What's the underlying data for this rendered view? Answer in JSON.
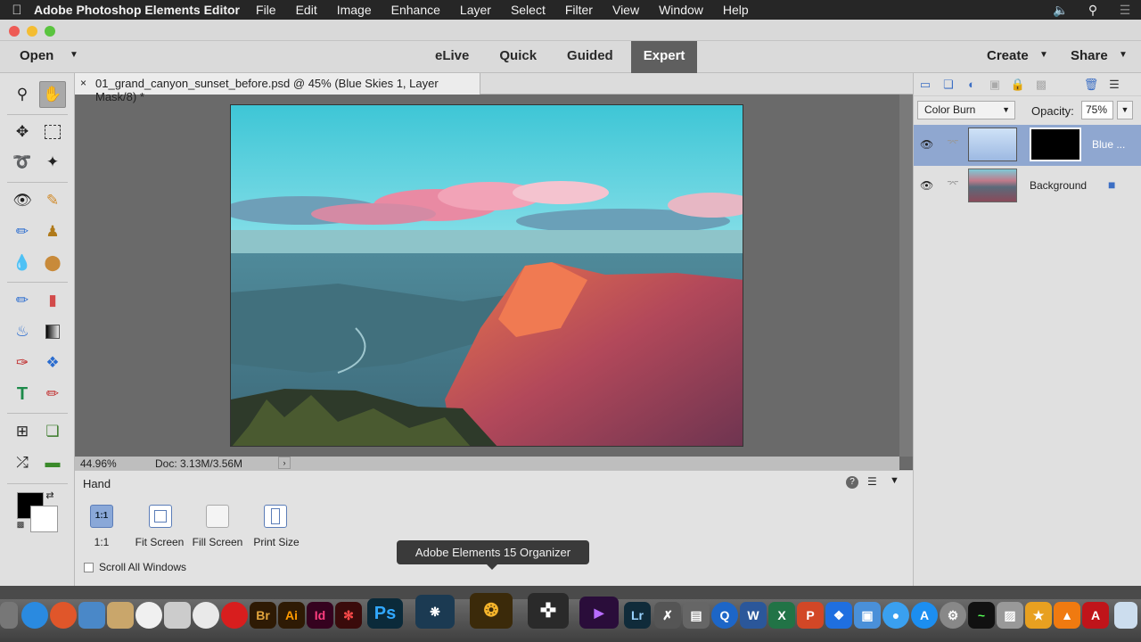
{
  "menubar": {
    "apple": "",
    "app_name": "Adobe Photoshop Elements Editor",
    "items": [
      "File",
      "Edit",
      "Image",
      "Enhance",
      "Layer",
      "Select",
      "Filter",
      "View",
      "Window",
      "Help"
    ],
    "right_icons": [
      "volume-icon",
      "search-icon",
      "list-icon"
    ]
  },
  "topbar": {
    "open": "Open",
    "modes": [
      "eLive",
      "Quick",
      "Guided",
      "Expert"
    ],
    "active_mode": "Expert",
    "create": "Create",
    "share": "Share"
  },
  "document": {
    "close": "×",
    "tab_title": "01_grand_canyon_sunset_before.psd @ 45% (Blue Skies 1, Layer Mask/8) *"
  },
  "status": {
    "zoom": "44.96%",
    "doc_size": "Doc: 3.13M/3.56M",
    "arrow": "›"
  },
  "options": {
    "title": "Hand",
    "help": "?",
    "buttons": [
      {
        "icon": "1:1",
        "label": "1:1"
      },
      {
        "icon": "",
        "label": "Fit Screen"
      },
      {
        "icon": "",
        "label": "Fill Screen"
      },
      {
        "icon": "",
        "label": "Print Size"
      }
    ],
    "scroll_all": "Scroll All Windows"
  },
  "tooltip": "Adobe Elements 15 Organizer",
  "layers": {
    "blend_mode": "Color Burn",
    "opacity_label": "Opacity:",
    "opacity_value": "75%",
    "items": [
      {
        "name": "Blue ..."
      },
      {
        "name": "Background"
      }
    ]
  },
  "dock": {
    "labels": [
      "Br",
      "Ai",
      "Id",
      "Ps",
      "Lr"
    ]
  },
  "colors": {
    "accent": "#3c6fc4",
    "selected_layer": "#8fa7d0",
    "active_mode": "#5f5f5f"
  }
}
